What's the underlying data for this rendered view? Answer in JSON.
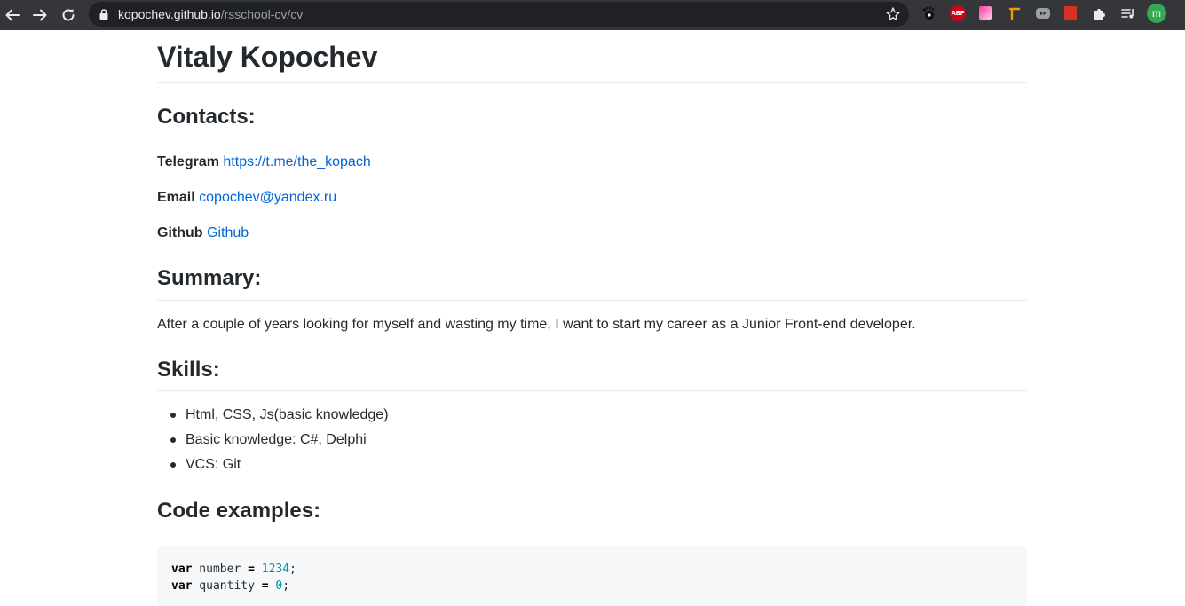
{
  "browser": {
    "url_host": "kopochev.github.io",
    "url_path": "/rsschool-cv/cv",
    "nav": {
      "back_icon": "arrow-left-icon",
      "forward_icon": "arrow-right-icon",
      "reload_icon": "reload-icon"
    },
    "extensions": [
      {
        "name": "gnome-extension-icon"
      },
      {
        "name": "adblock-plus-extension-icon",
        "label": "ABP"
      },
      {
        "name": "color-picker-extension-icon"
      },
      {
        "name": "ruler-extension-icon"
      },
      {
        "name": "media-extension-icon"
      },
      {
        "name": "bookmark-extension-icon"
      },
      {
        "name": "extensions-puzzle-icon"
      },
      {
        "name": "media-queue-icon"
      }
    ],
    "profile_initial": "m",
    "colors": {
      "chrome_bg": "#35363a",
      "omnibox_bg": "#202124",
      "profile": "#34a853"
    }
  },
  "page": {
    "title": "Vitaly Kopochev",
    "contacts": {
      "heading": "Contacts:",
      "telegram_label": "Telegram",
      "telegram_value": "https://t.me/the_kopach",
      "email_label": "Email",
      "email_value": "copochev@yandex.ru",
      "github_label": "Github",
      "github_value": "Github"
    },
    "summary": {
      "heading": "Summary:",
      "text": "After a couple of years looking for myself and wasting my time, I want to start my career as a Junior Front-end developer."
    },
    "skills": {
      "heading": "Skills:",
      "items": [
        "Html, CSS, Js(basic knowledge)",
        "Basic knowledge: C#, Delphi",
        "VCS: Git"
      ]
    },
    "code": {
      "heading": "Code examples:",
      "lines": [
        {
          "keyword": "var",
          "name": " number ",
          "op": "=",
          "value": "1234",
          "end": ";"
        },
        {
          "keyword": "var",
          "name": " quantity ",
          "op": "=",
          "value": "0",
          "end": ";"
        }
      ]
    },
    "colors": {
      "text": "#24292e",
      "link": "#0366d6",
      "code_bg": "#f6f8fa",
      "number": "#009999"
    }
  }
}
